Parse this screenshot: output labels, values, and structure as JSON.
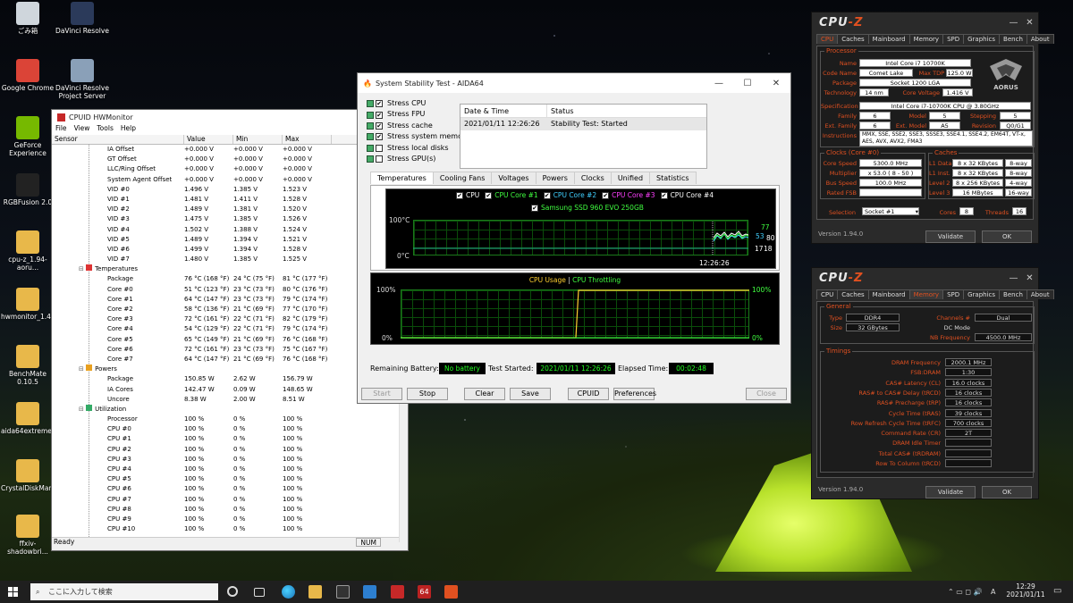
{
  "desktop": {
    "icons": [
      {
        "label": "ごみ箱",
        "color": "#cfd6dc"
      },
      {
        "label": "DaVinci Resolve",
        "color": "#2b3a5a"
      },
      {
        "label": "Google Chrome",
        "color": "#db4437"
      },
      {
        "label": "DaVinci Resolve Project Server",
        "color": "#8aa0b8"
      },
      {
        "label": "GeForce Experience",
        "color": "#76b900"
      },
      {
        "label": "RGBFusion 2.0",
        "color": "#222"
      },
      {
        "label": "cpu-z_1.94-aoru...",
        "color": "#e8b84a"
      },
      {
        "label": "hwmonitor_1.43",
        "color": "#e8b84a"
      },
      {
        "label": "BenchMate 0.10.5",
        "color": "#e8b84a"
      },
      {
        "label": "aida64extreme62",
        "color": "#e8b84a"
      },
      {
        "label": "CrystalDiskMark...",
        "color": "#e8b84a"
      },
      {
        "label": "ffxiv-shadowbri...",
        "color": "#e8b84a"
      }
    ]
  },
  "hwmonitor": {
    "title": "CPUID HWMonitor",
    "menu": [
      "File",
      "View",
      "Tools",
      "Help"
    ],
    "columns": [
      "Sensor",
      "Value",
      "Min",
      "Max"
    ],
    "rows": [
      {
        "s": "IA Offset",
        "v": "+0.000 V",
        "mn": "+0.000 V",
        "mx": "+0.000 V",
        "lvl": 2
      },
      {
        "s": "GT Offset",
        "v": "+0.000 V",
        "mn": "+0.000 V",
        "mx": "+0.000 V",
        "lvl": 2
      },
      {
        "s": "LLC/Ring Offset",
        "v": "+0.000 V",
        "mn": "+0.000 V",
        "mx": "+0.000 V",
        "lvl": 2
      },
      {
        "s": "System Agent Offset",
        "v": "+0.000 V",
        "mn": "+0.000 V",
        "mx": "+0.000 V",
        "lvl": 2
      },
      {
        "s": "VID #0",
        "v": "1.496 V",
        "mn": "1.385 V",
        "mx": "1.523 V",
        "lvl": 2
      },
      {
        "s": "VID #1",
        "v": "1.481 V",
        "mn": "1.411 V",
        "mx": "1.528 V",
        "lvl": 2
      },
      {
        "s": "VID #2",
        "v": "1.489 V",
        "mn": "1.381 V",
        "mx": "1.520 V",
        "lvl": 2
      },
      {
        "s": "VID #3",
        "v": "1.475 V",
        "mn": "1.385 V",
        "mx": "1.526 V",
        "lvl": 2
      },
      {
        "s": "VID #4",
        "v": "1.502 V",
        "mn": "1.388 V",
        "mx": "1.524 V",
        "lvl": 2
      },
      {
        "s": "VID #5",
        "v": "1.489 V",
        "mn": "1.394 V",
        "mx": "1.521 V",
        "lvl": 2
      },
      {
        "s": "VID #6",
        "v": "1.499 V",
        "mn": "1.394 V",
        "mx": "1.528 V",
        "lvl": 2
      },
      {
        "s": "VID #7",
        "v": "1.480 V",
        "mn": "1.385 V",
        "mx": "1.525 V",
        "lvl": 2
      },
      {
        "s": "Temperatures",
        "v": "",
        "mn": "",
        "mx": "",
        "lvl": 1
      },
      {
        "s": "Package",
        "v": "76 °C (168 °F)",
        "mn": "24 °C (75 °F)",
        "mx": "81 °C (177 °F)",
        "lvl": 2
      },
      {
        "s": "Core #0",
        "v": "51 °C (123 °F)",
        "mn": "23 °C (73 °F)",
        "mx": "80 °C (176 °F)",
        "lvl": 2
      },
      {
        "s": "Core #1",
        "v": "64 °C (147 °F)",
        "mn": "23 °C (73 °F)",
        "mx": "79 °C (174 °F)",
        "lvl": 2
      },
      {
        "s": "Core #2",
        "v": "58 °C (136 °F)",
        "mn": "21 °C (69 °F)",
        "mx": "77 °C (170 °F)",
        "lvl": 2
      },
      {
        "s": "Core #3",
        "v": "72 °C (161 °F)",
        "mn": "22 °C (71 °F)",
        "mx": "82 °C (179 °F)",
        "lvl": 2
      },
      {
        "s": "Core #4",
        "v": "54 °C (129 °F)",
        "mn": "22 °C (71 °F)",
        "mx": "79 °C (174 °F)",
        "lvl": 2
      },
      {
        "s": "Core #5",
        "v": "65 °C (149 °F)",
        "mn": "21 °C (69 °F)",
        "mx": "76 °C (168 °F)",
        "lvl": 2
      },
      {
        "s": "Core #6",
        "v": "72 °C (161 °F)",
        "mn": "23 °C (73 °F)",
        "mx": "75 °C (167 °F)",
        "lvl": 2
      },
      {
        "s": "Core #7",
        "v": "64 °C (147 °F)",
        "mn": "21 °C (69 °F)",
        "mx": "76 °C (168 °F)",
        "lvl": 2
      },
      {
        "s": "Powers",
        "v": "",
        "mn": "",
        "mx": "",
        "lvl": 1
      },
      {
        "s": "Package",
        "v": "150.85 W",
        "mn": "2.62 W",
        "mx": "156.79 W",
        "lvl": 2
      },
      {
        "s": "IA Cores",
        "v": "142.47 W",
        "mn": "0.09 W",
        "mx": "148.65 W",
        "lvl": 2
      },
      {
        "s": "Uncore",
        "v": "8.38 W",
        "mn": "2.00 W",
        "mx": "8.51 W",
        "lvl": 2
      },
      {
        "s": "Utilization",
        "v": "",
        "mn": "",
        "mx": "",
        "lvl": 1
      },
      {
        "s": "Processor",
        "v": "100 %",
        "mn": "0 %",
        "mx": "100 %",
        "lvl": 2
      },
      {
        "s": "CPU #0",
        "v": "100 %",
        "mn": "0 %",
        "mx": "100 %",
        "lvl": 2
      },
      {
        "s": "CPU #1",
        "v": "100 %",
        "mn": "0 %",
        "mx": "100 %",
        "lvl": 2
      },
      {
        "s": "CPU #2",
        "v": "100 %",
        "mn": "0 %",
        "mx": "100 %",
        "lvl": 2
      },
      {
        "s": "CPU #3",
        "v": "100 %",
        "mn": "0 %",
        "mx": "100 %",
        "lvl": 2
      },
      {
        "s": "CPU #4",
        "v": "100 %",
        "mn": "0 %",
        "mx": "100 %",
        "lvl": 2
      },
      {
        "s": "CPU #5",
        "v": "100 %",
        "mn": "0 %",
        "mx": "100 %",
        "lvl": 2
      },
      {
        "s": "CPU #6",
        "v": "100 %",
        "mn": "0 %",
        "mx": "100 %",
        "lvl": 2
      },
      {
        "s": "CPU #7",
        "v": "100 %",
        "mn": "0 %",
        "mx": "100 %",
        "lvl": 2
      },
      {
        "s": "CPU #8",
        "v": "100 %",
        "mn": "0 %",
        "mx": "100 %",
        "lvl": 2
      },
      {
        "s": "CPU #9",
        "v": "100 %",
        "mn": "0 %",
        "mx": "100 %",
        "lvl": 2
      },
      {
        "s": "CPU #10",
        "v": "100 %",
        "mn": "0 %",
        "mx": "100 %",
        "lvl": 2
      }
    ],
    "status_left": "Ready",
    "status_right": "NUM"
  },
  "aida": {
    "title": "System Stability Test - AIDA64",
    "stress": [
      {
        "label": "Stress CPU",
        "checked": true
      },
      {
        "label": "Stress FPU",
        "checked": true
      },
      {
        "label": "Stress cache",
        "checked": true
      },
      {
        "label": "Stress system memo",
        "checked": true
      },
      {
        "label": "Stress local disks",
        "checked": false
      },
      {
        "label": "Stress GPU(s)",
        "checked": false
      }
    ],
    "log_headers": [
      "Date & Time",
      "Status"
    ],
    "log_row": [
      "2021/01/11 12:26:26",
      "Stability Test: Started"
    ],
    "tabs": [
      "Temperatures",
      "Cooling Fans",
      "Voltages",
      "Powers",
      "Clocks",
      "Unified",
      "Statistics"
    ],
    "temp_legend": [
      {
        "label": "CPU",
        "color": "#ffffff"
      },
      {
        "label": "CPU Core #1",
        "color": "#40ff40"
      },
      {
        "label": "CPU Core #2",
        "color": "#40d0ff"
      },
      {
        "label": "CPU Core #3",
        "color": "#ff40ff"
      },
      {
        "label": "CPU Core #4",
        "color": "#ffffff"
      }
    ],
    "ssd_legend": "Samsung SSD 960 EVO 250GB",
    "temp_top": "100°C",
    "temp_bottom": "0°C",
    "temp_time": "12:26:26",
    "temp_vals": [
      "77",
      "53",
      "80",
      "17",
      "18"
    ],
    "usage_title": "CPU Usage",
    "usage_sep": "|",
    "throttle_title": "CPU Throttling",
    "usage_top_left": "100%",
    "usage_top_right": "100%",
    "usage_bot_left": "0%",
    "usage_bot_right": "0%",
    "battery_label": "Remaining Battery:",
    "battery_value": "No battery",
    "started_label": "Test Started:",
    "started_value": "2021/01/11 12:26:26",
    "elapsed_label": "Elapsed Time:",
    "elapsed_value": "00:02:48",
    "buttons": [
      "Start",
      "Stop",
      "Clear",
      "Save",
      "CPUID",
      "Preferences",
      "Close"
    ]
  },
  "cpuz_cpu": {
    "title_a": "CPU",
    "title_b": "-Z",
    "tabs": [
      "CPU",
      "Caches",
      "Mainboard",
      "Memory",
      "SPD",
      "Graphics",
      "Bench",
      "About"
    ],
    "processor_legend": "Processor",
    "name_k": "Name",
    "name_v": "Intel Core i7 10700K",
    "code_k": "Code Name",
    "code_v": "Comet Lake",
    "tdp_k": "Max TDP",
    "tdp_v": "125.0 W",
    "pkg_k": "Package",
    "pkg_v": "Socket 1200 LGA",
    "tech_k": "Technology",
    "tech_v": "14 nm",
    "volt_k": "Core Voltage",
    "volt_v": "1.416 V",
    "spec_k": "Specification",
    "spec_v": "Intel Core i7-10700K CPU @ 3.80GHz",
    "fam_k": "Family",
    "fam_v": "6",
    "model_k": "Model",
    "model_v": "5",
    "step_k": "Stepping",
    "step_v": "5",
    "efam_k": "Ext. Family",
    "efam_v": "6",
    "emodel_k": "Ext. Model",
    "emodel_v": "A5",
    "rev_k": "Revision",
    "rev_v": "Q0/G1",
    "instr_k": "Instructions",
    "instr_v": "MMX, SSE, SSE2, SSE3, SSSE3, SSE4.1, SSE4.2, EM64T, VT-x, AES, AVX, AVX2, FMA3",
    "clocks_legend": "Clocks (Core #0)",
    "cs_k": "Core Speed",
    "cs_v": "5300.0 MHz",
    "mul_k": "Multiplier",
    "mul_v": "x 53.0 ( 8 - 50 )",
    "bus_k": "Bus Speed",
    "bus_v": "100.0 MHz",
    "fsb_k": "Rated FSB",
    "fsb_v": "",
    "caches_legend": "Caches",
    "l1d_k": "L1 Data",
    "l1d_v": "8 x 32 KBytes",
    "l1d_w": "8-way",
    "l1i_k": "L1 Inst.",
    "l1i_v": "8 x 32 KBytes",
    "l1i_w": "8-way",
    "l2_k": "Level 2",
    "l2_v": "8 x 256 KBytes",
    "l2_w": "4-way",
    "l3_k": "Level 3",
    "l3_v": "16 MBytes",
    "l3_w": "16-way",
    "sel_k": "Selection",
    "sel_v": "Socket #1",
    "cores_k": "Cores",
    "cores_v": "8",
    "thr_k": "Threads",
    "thr_v": "16",
    "version": "Version 1.94.0",
    "validate": "Validate",
    "ok": "OK",
    "logo": "AORUS"
  },
  "cpuz_mem": {
    "title_a": "CPU",
    "title_b": "-Z",
    "tabs": [
      "CPU",
      "Caches",
      "Mainboard",
      "Memory",
      "SPD",
      "Graphics",
      "Bench",
      "About"
    ],
    "general_legend": "General",
    "type_k": "Type",
    "type_v": "DDR4",
    "size_k": "Size",
    "size_v": "32 GBytes",
    "ch_k": "Channels #",
    "ch_v": "Dual",
    "dc_k": "DC Mode",
    "dc_v": "",
    "nb_k": "NB Frequency",
    "nb_v": "4500.0 MHz",
    "timings_legend": "Timings",
    "timings": [
      {
        "k": "DRAM Frequency",
        "v": "2000.1 MHz"
      },
      {
        "k": "FSB:DRAM",
        "v": "1:30"
      },
      {
        "k": "CAS# Latency (CL)",
        "v": "16.0 clocks"
      },
      {
        "k": "RAS# to CAS# Delay (tRCD)",
        "v": "16 clocks"
      },
      {
        "k": "RAS# Precharge (tRP)",
        "v": "16 clocks"
      },
      {
        "k": "Cycle Time (tRAS)",
        "v": "39 clocks"
      },
      {
        "k": "Row Refresh Cycle Time (tRFC)",
        "v": "700 clocks"
      },
      {
        "k": "Command Rate (CR)",
        "v": "2T"
      },
      {
        "k": "DRAM Idle Timer",
        "v": ""
      },
      {
        "k": "Total CAS# (tRDRAM)",
        "v": ""
      },
      {
        "k": "Row To Column (tRCD)",
        "v": ""
      }
    ],
    "version": "Version 1.94.0",
    "validate": "Validate",
    "ok": "OK"
  },
  "taskbar": {
    "search_placeholder": "ここに入力して検索",
    "time": "12:29",
    "date": "2021/01/11",
    "lang": "A"
  }
}
